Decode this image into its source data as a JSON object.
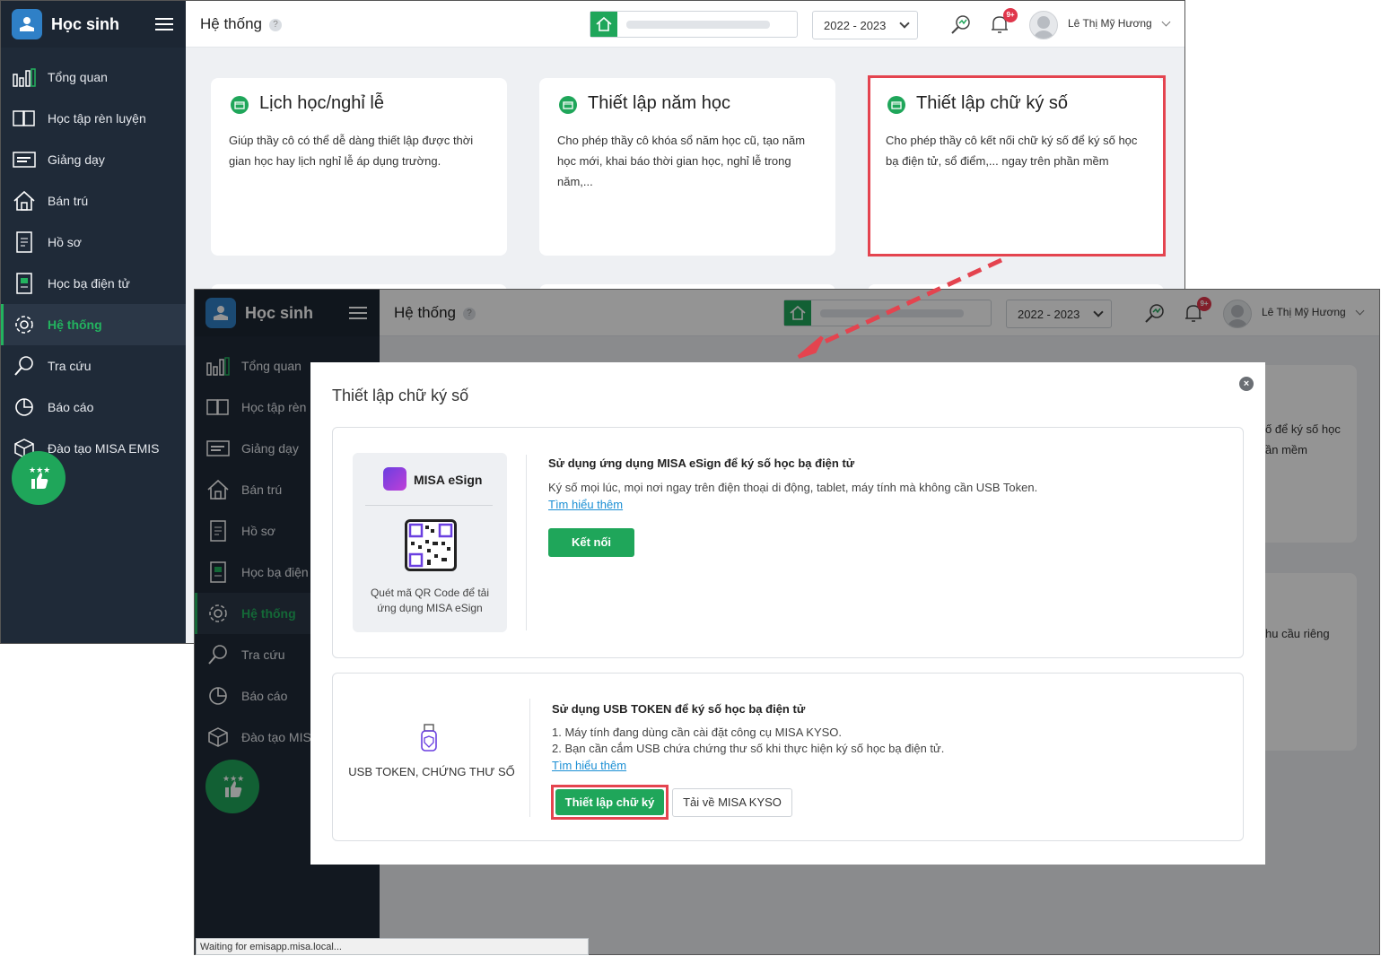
{
  "app": {
    "name": "Học sinh",
    "page_title": "Hệ thống",
    "help_mark": "?",
    "year": "2022 - 2023",
    "user_name": "Lê Thị Mỹ Hương",
    "notif_count": "9+"
  },
  "sidebar": {
    "items": [
      {
        "label": "Tổng quan",
        "icon": "bar-chart-icon"
      },
      {
        "label": "Học tập rèn luyện",
        "icon": "book-icon"
      },
      {
        "label": "Giảng dạy",
        "icon": "board-icon"
      },
      {
        "label": "Bán trú",
        "icon": "house-icon"
      },
      {
        "label": "Hồ sơ",
        "icon": "document-icon"
      },
      {
        "label": "Học bạ điện tử",
        "icon": "ebook-icon"
      },
      {
        "label": "Hệ thống",
        "icon": "gear-icon",
        "active": true
      },
      {
        "label": "Tra cứu",
        "icon": "search-icon"
      },
      {
        "label": "Báo cáo",
        "icon": "pie-chart-icon"
      },
      {
        "label": "Đào tạo MISA EMIS",
        "icon": "cube-icon"
      }
    ],
    "items_back": [
      {
        "label": "Tổng quan"
      },
      {
        "label": "Học tập rèn l"
      },
      {
        "label": "Giảng dạy"
      },
      {
        "label": "Bán trú"
      },
      {
        "label": "Hồ sơ"
      },
      {
        "label": "Học bạ điện t"
      },
      {
        "label": "Hệ thống"
      },
      {
        "label": "Tra cứu"
      },
      {
        "label": "Báo cáo"
      },
      {
        "label": "Đào tạo MISA"
      }
    ]
  },
  "cards": [
    {
      "title": "Lịch học/nghỉ lễ",
      "desc": "Giúp thầy cô có thể dễ dàng thiết lập được thời gian học hay lịch nghỉ lễ áp dụng trường."
    },
    {
      "title": "Thiết lập năm học",
      "desc": "Cho phép thầy cô khóa sổ năm học cũ, tạo năm học mới, khai báo thời gian học, nghỉ lễ trong năm,..."
    },
    {
      "title": "Thiết lập chữ ký số",
      "desc": "Cho phép thầy cô kết nối chữ ký số để ký số học bạ điện tử, sổ điểm,... ngay trên phần mềm"
    }
  ],
  "background_fragments": {
    "frag1_line1": "ố để ký số học",
    "frag1_line2": "ần mềm",
    "frag2": "hu cầu riêng"
  },
  "modal": {
    "title": "Thiết lập chữ ký số",
    "close": "×",
    "esign": {
      "brand": "MISA eSign",
      "qr_text": "Quét mã QR Code để tải ứng dụng MISA eSign",
      "heading": "Sử dụng ứng dụng MISA eSign để ký số học bạ điện tử",
      "desc": "Ký số mọi lúc, mọi nơi ngay trên điện thoại di động, tablet, máy tính mà không cần USB Token.",
      "link": "Tìm hiểu thêm",
      "button": "Kết nối"
    },
    "usb": {
      "label": "USB TOKEN, CHỨNG THƯ SỐ",
      "heading": "Sử dụng USB TOKEN để ký số học bạ điện tử",
      "line1": "1. Máy tính đang dùng cần cài đặt công cụ MISA KYSO.",
      "line2": "2. Bạn cần cắm USB chứa chứng thư số khi thực hiện ký số học bạ điện tử.",
      "link": "Tìm hiểu thêm",
      "primary_button": "Thiết lập chữ ký",
      "secondary_button": "Tải về MISA KYSO"
    }
  },
  "status_bar": "Waiting for emisapp.misa.local...",
  "colors": {
    "brand_green": "#1fa65a",
    "sidebar_bg": "#1f2a38",
    "highlight_red": "#e4444f",
    "link_blue": "#1b8fd4"
  }
}
